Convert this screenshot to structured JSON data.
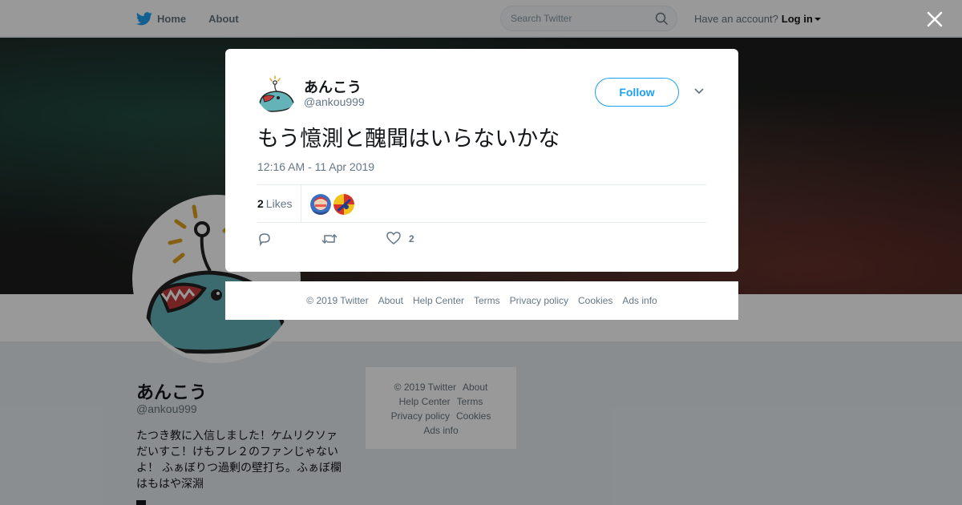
{
  "topbar": {
    "home_label": "Home",
    "about_label": "About",
    "search_placeholder": "Search Twitter",
    "account_prompt": "Have an account?",
    "login_label": "Log in"
  },
  "profile": {
    "name": "あんこう",
    "handle": "@ankou999",
    "bio_lines": [
      "たつき教に入信しました！ケムリクソァ",
      "だいすこ！けもフレ２のファンじゃない",
      "よ！ ふぁぼりつ過剰の壁打ち。ふぁぼ欄",
      "はもはや深淵"
    ]
  },
  "side_footer": {
    "copyright": "© 2019 Twitter",
    "about": "About",
    "help": "Help Center",
    "terms": "Terms",
    "privacy": "Privacy policy",
    "cookies": "Cookies",
    "ads": "Ads info"
  },
  "tweet": {
    "author_name": "あんこう",
    "author_handle": "@ankou999",
    "follow_label": "Follow",
    "text": "もう憶測と醜聞はいらないかな",
    "timestamp": "12:16 AM - 11 Apr 2019",
    "likes_count": "2",
    "likes_label": "Likes",
    "like_action_count": "2"
  },
  "modal_footer": {
    "copyright": "© 2019 Twitter",
    "about": "About",
    "help": "Help Center",
    "terms": "Terms",
    "privacy": "Privacy policy",
    "cookies": "Cookies",
    "ads": "Ads info"
  },
  "icons": {
    "twitter_bird": "twitter-bird-icon",
    "search": "search-icon",
    "close": "close-icon",
    "chevron": "chevron-down-icon",
    "reply": "reply-icon",
    "retweet": "retweet-icon",
    "like": "heart-icon"
  },
  "colors": {
    "brand": "#1da1f2",
    "text": "#14171a",
    "muted": "#657786"
  }
}
